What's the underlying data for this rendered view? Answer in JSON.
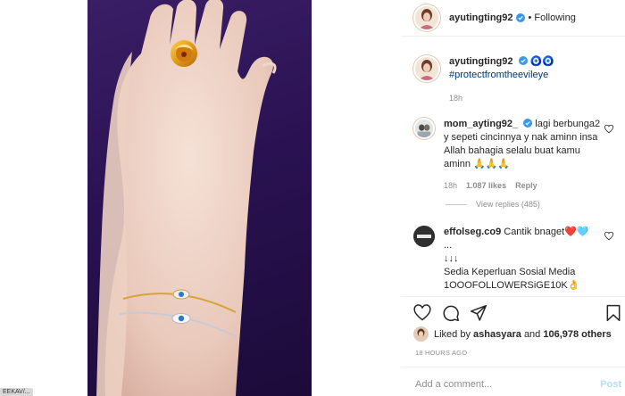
{
  "left_stub": {
    "label": "EEKAV/..."
  },
  "post_header": {
    "username": "ayutingting92",
    "separator": "•",
    "follow_status": "Following"
  },
  "caption": {
    "username": "ayutingting92",
    "emoji": "🧿🧿",
    "hashtag": "#protectfromtheevileye",
    "time": "18h"
  },
  "comments": [
    {
      "username": "mom_ayting92_",
      "text": "lagi berbunga2 y sepeti cincinnya y nak aminn insa Allah bahagia selalu buat kamu aminn 🙏🙏🙏",
      "time": "18h",
      "likes": "1.087 likes",
      "reply": "Reply",
      "view_replies": "View replies (485)"
    },
    {
      "username": "effolseg.co9",
      "text_line1": "Cantik bnaget❤️🩵",
      "text_line2": "...",
      "text_line3": "↓↓↓",
      "text_line4": "Sedia Keperluan Sosial Media",
      "text_line5": "1OOOFOLLOWERSiGE10K👌"
    }
  ],
  "likes_line": {
    "prefix": "Liked by ",
    "user": "ashasyara",
    "middle": " and ",
    "count": "106,978 others"
  },
  "timestamp": "18 HOURS AGO",
  "comment_box": {
    "placeholder": "Add a comment...",
    "post_label": "Post"
  },
  "icons": [
    "heart-icon",
    "comment-icon",
    "share-icon",
    "bookmark-icon",
    "verified-icon"
  ],
  "colors": {
    "verified": "#3897f0",
    "link": "#00376b",
    "muted": "#8e8e8e",
    "post_disabled": "#b2dffc",
    "photo_bg": "#2a1252"
  }
}
